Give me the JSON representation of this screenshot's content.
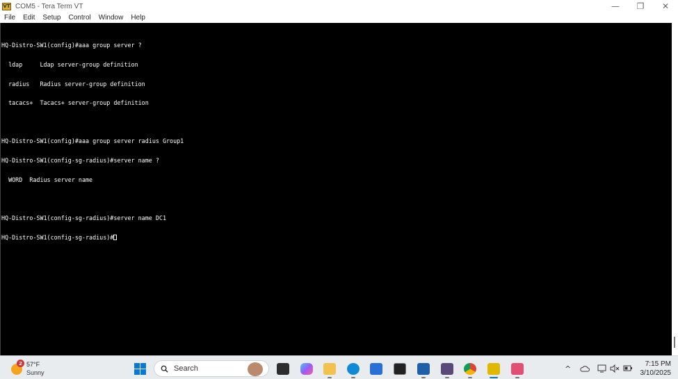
{
  "window": {
    "title": "COM5 - Tera Term VT",
    "icon_label": "VT",
    "controls": {
      "minimize": "—",
      "restore": "❐",
      "close": "✕"
    }
  },
  "menu": {
    "items": [
      "File",
      "Edit",
      "Setup",
      "Control",
      "Window",
      "Help"
    ]
  },
  "terminal": {
    "lines": [
      "HQ-Distro-SW1(config)#aaa group server ?",
      "  ldap     Ldap server-group definition",
      "  radius   Radius server-group definition",
      "  tacacs+  Tacacs+ server-group definition",
      "",
      "HQ-Distro-SW1(config)#aaa group server radius Group1",
      "HQ-Distro-SW1(config-sg-radius)#server name ?",
      "  WORD  Radius server name",
      "",
      "HQ-Distro-SW1(config-sg-radius)#server name DC1",
      "HQ-Distro-SW1(config-sg-radius)#"
    ],
    "colors": {
      "background": "#000000",
      "foreground": "#ffffff"
    }
  },
  "taskbar": {
    "weather": {
      "badge": "2",
      "temperature": "57°F",
      "condition": "Sunny"
    },
    "search": {
      "label": "Search"
    },
    "apps": [
      {
        "name": "task-view-icon",
        "color": "#333333"
      },
      {
        "name": "copilot-icon",
        "color": "#7a5af5"
      },
      {
        "name": "file-explorer-icon",
        "color": "#f2c14e"
      },
      {
        "name": "edge-icon",
        "color": "#0f8ad6"
      },
      {
        "name": "store-icon",
        "color": "#2a6fd6"
      },
      {
        "name": "terminal-icon",
        "color": "#222222"
      },
      {
        "name": "visio-icon",
        "color": "#1f5fa8"
      },
      {
        "name": "calendar-app-icon",
        "color": "#5a4a7a"
      },
      {
        "name": "chrome-icon",
        "color": "#db4437"
      },
      {
        "name": "teraterm-icon",
        "color": "#e0b800"
      },
      {
        "name": "snipping-tool-icon",
        "color": "#e34f73"
      }
    ],
    "tray": {
      "chevron": "^"
    },
    "clock": {
      "time": "7:15 PM",
      "date": "3/10/2025"
    }
  }
}
